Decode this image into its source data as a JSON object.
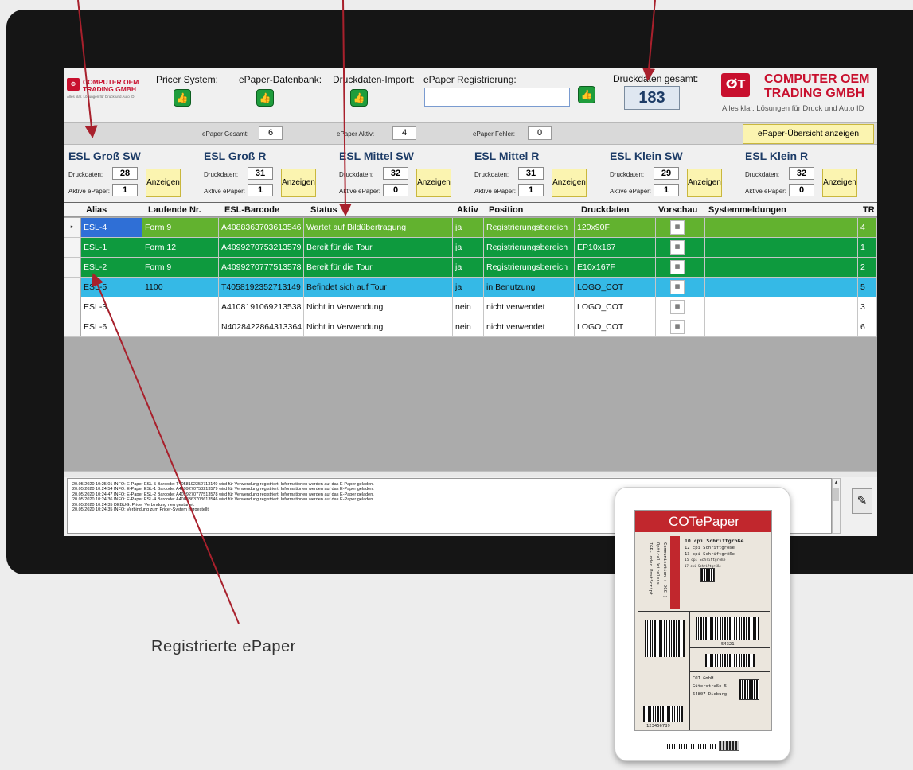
{
  "header": {
    "logo_small": {
      "line1": "COMPUTER OEM",
      "line2": "TRADING GMBH",
      "tagline": "Alles klar. Lösungen für Druck und Auto ID"
    },
    "pricer_label": "Pricer System:",
    "db_label": "ePaper-Datenbank:",
    "import_label": "Druckdaten-Import:",
    "registration_label": "ePaper Registrierung:",
    "registration_value": "",
    "total_label": "Druckdaten gesamt:",
    "total_value": "183",
    "logo_big": {
      "mark": "ⵚT",
      "line1": "COMPUTER OEM",
      "line2": "TRADING GMBH",
      "tagline": "Alles klar. Lösungen für Druck und Auto ID"
    }
  },
  "counts": {
    "total_label": "ePaper Gesamt:",
    "total": "6",
    "active_label": "ePaper Aktiv:",
    "active": "4",
    "error_label": "ePaper Fehler:",
    "error": "0",
    "overview_button": "ePaper-Übersicht anzeigen"
  },
  "panels": [
    {
      "title": "ESL Groß SW",
      "druck_label": "Druckdaten:",
      "druck": "28",
      "aktiv_label": "Aktive ePaper:",
      "aktiv": "1",
      "button": "Anzeigen"
    },
    {
      "title": "ESL Groß R",
      "druck_label": "Druckdaten:",
      "druck": "31",
      "aktiv_label": "Aktive ePaper:",
      "aktiv": "1",
      "button": "Anzeigen"
    },
    {
      "title": "ESL Mittel SW",
      "druck_label": "Druckdaten:",
      "druck": "32",
      "aktiv_label": "Aktive ePaper:",
      "aktiv": "0",
      "button": "Anzeigen"
    },
    {
      "title": "ESL Mittel R",
      "druck_label": "Druckdaten:",
      "druck": "31",
      "aktiv_label": "Aktive ePaper:",
      "aktiv": "1",
      "button": "Anzeigen"
    },
    {
      "title": "ESL Klein SW",
      "druck_label": "Druckdaten:",
      "druck": "29",
      "aktiv_label": "Aktive ePaper:",
      "aktiv": "1",
      "button": "Anzeigen"
    },
    {
      "title": "ESL Klein R",
      "druck_label": "Druckdaten:",
      "druck": "32",
      "aktiv_label": "Aktive ePaper:",
      "aktiv": "0",
      "button": "Anzeigen"
    }
  ],
  "table": {
    "columns": [
      "Alias",
      "Laufende Nr.",
      "ESL-Barcode",
      "Status",
      "Aktiv",
      "Position",
      "Druckdaten",
      "Vorschau",
      "Systemmeldungen",
      "TR"
    ],
    "rows": [
      {
        "alias": "ESL-4",
        "nr": "Form 9",
        "barcode": "A4088363703613546",
        "status": "Wartet auf Bildübertragung",
        "aktiv": "ja",
        "position": "Registrierungsbereich",
        "druck": "120x90F",
        "msg": "",
        "tr": "4",
        "color": "#62b22f"
      },
      {
        "alias": "ESL-1",
        "nr": "Form 12",
        "barcode": "A4099270753213579",
        "status": "Bereit für die Tour",
        "aktiv": "ja",
        "position": "Registrierungsbereich",
        "druck": "EP10x167",
        "msg": "",
        "tr": "1",
        "color": "#0e9a3e"
      },
      {
        "alias": "ESL-2",
        "nr": "Form 9",
        "barcode": "A4099270777513578",
        "status": "Bereit für die Tour",
        "aktiv": "ja",
        "position": "Registrierungsbereich",
        "druck": "E10x167F",
        "msg": "",
        "tr": "2",
        "color": "#0e9a3e"
      },
      {
        "alias": "ESL-5",
        "nr": "1100",
        "barcode": "T4058192352713149",
        "status": "Befindet sich auf Tour",
        "aktiv": "ja",
        "position": "in Benutzung",
        "druck": "LOGO_COT",
        "msg": "",
        "tr": "5",
        "color": "#35b9e6"
      },
      {
        "alias": "ESL-3",
        "nr": "",
        "barcode": "A4108191069213538",
        "status": "Nicht in Verwendung",
        "aktiv": "nein",
        "position": "nicht verwendet",
        "druck": "LOGO_COT",
        "msg": "",
        "tr": "3",
        "color": "#ffffff"
      },
      {
        "alias": "ESL-6",
        "nr": "",
        "barcode": "N4028422864313364",
        "status": "Nicht in Verwendung",
        "aktiv": "nein",
        "position": "nicht verwendet",
        "druck": "LOGO_COT",
        "msg": "",
        "tr": "6",
        "color": "#ffffff"
      }
    ],
    "selected_alias_color": "#2f6fd6"
  },
  "log": [
    "20.05.2020 10:25:01 INFO: E-Paper ESL-5 Barcode: T4058192352713149 wird für Verwendung registriert, Informationen werden auf das E-Paper geladen.",
    "20.05.2020 10:24:54 INFO: E-Paper ESL-1 Barcode: A4099270753213579 wird für Verwendung registriert, Informationen werden auf das E-Paper geladen.",
    "20.05.2020 10:24:47 INFO: E-Paper ESL-2 Barcode: A4099270777513578 wird für Verwendung registriert, Informationen werden auf das E-Paper geladen.",
    "20.05.2020 10:24:36 INFO: E-Paper ESL-4 Barcode: A4088363703613546 wird für Verwendung registriert, Informationen werden auf das E-Paper geladen.",
    "20.05.2020 10:24:35 DEBUG: Pricer Verbindung neu gestartet.",
    "20.05.2020 10:24:35 INFO: Verbindung zum Pricer-System hergestellt."
  ],
  "annotation": {
    "caption": "Registrierte ePaper",
    "arrow_color": "#a8202c"
  },
  "epaper_device": {
    "header": "COTePaper",
    "col1": [
      "Communication ( DGC )",
      "Optical Wireless",
      "IGP- oder PostScript"
    ],
    "col3": [
      "10 cpi Schriftgröße",
      "12 cpi Schriftgröße",
      "13 cpi Schriftgröße",
      "15 cpi Schriftgröße",
      "17 cpi Schriftgröße"
    ],
    "barcode_number_1": "54321",
    "barcode_number_2": "123456789",
    "address": [
      "COT GmbH",
      "Güterstraße 5",
      "64807 Dieburg"
    ]
  },
  "icons": {
    "thumb": "thumbs-up-icon",
    "row_pointer": "row-pointer-icon",
    "logo": "cot-logo-icon"
  }
}
